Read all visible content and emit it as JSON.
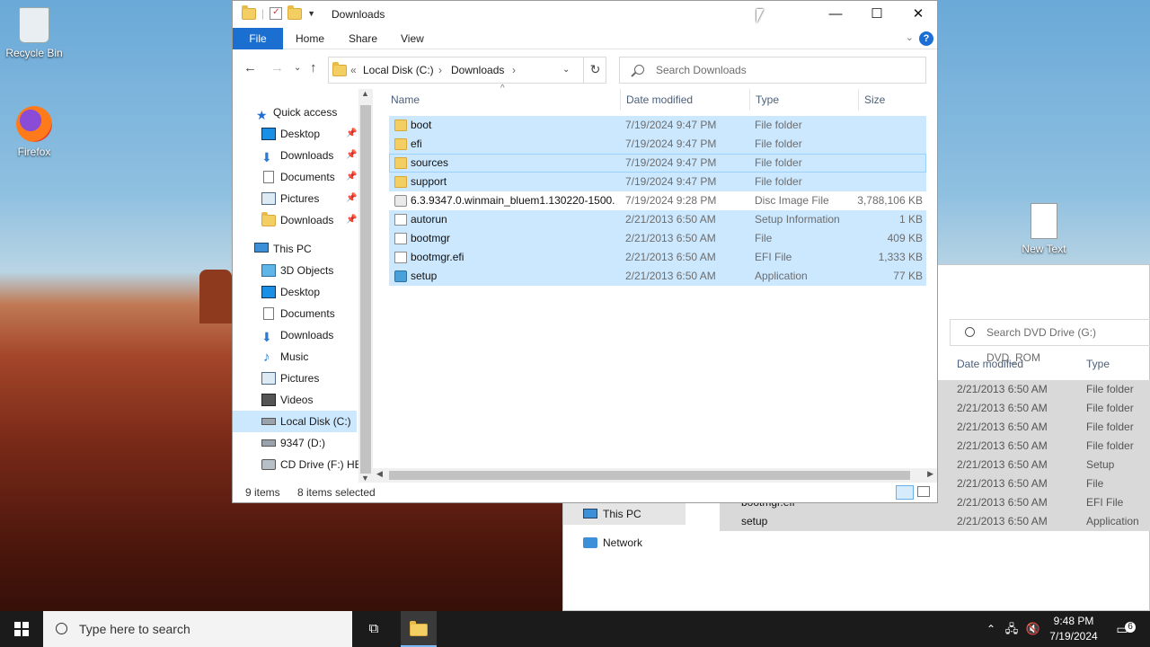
{
  "desktop": {
    "icons": [
      {
        "label": "Recycle Bin",
        "icon": "recycle-bin-icon"
      },
      {
        "label": "Firefox",
        "icon": "firefox-icon"
      },
      {
        "label": "New Text Document",
        "icon": "text-document-icon"
      }
    ]
  },
  "background_window": {
    "search_placeholder": "Search DVD Drive (G:) DVD_ROM",
    "col_date": "Date modified",
    "col_type": "Type",
    "nav": [
      {
        "label": "This PC",
        "icon": "computer-icon"
      },
      {
        "label": "Network",
        "icon": "network-icon"
      }
    ],
    "rows": [
      {
        "name": "",
        "date": "2/21/2013 6:50 AM",
        "type": "File folder"
      },
      {
        "name": "",
        "date": "2/21/2013 6:50 AM",
        "type": "File folder"
      },
      {
        "name": "",
        "date": "2/21/2013 6:50 AM",
        "type": "File folder"
      },
      {
        "name": "",
        "date": "2/21/2013 6:50 AM",
        "type": "File folder"
      },
      {
        "name": "",
        "date": "2/21/2013 6:50 AM",
        "type": "Setup Informa"
      },
      {
        "name": "",
        "date": "2/21/2013 6:50 AM",
        "type": "File"
      },
      {
        "name": "bootmgr.efi",
        "date": "2/21/2013 6:50 AM",
        "type": "EFI File"
      },
      {
        "name": "setup",
        "date": "2/21/2013 6:50 AM",
        "type": "Application"
      }
    ]
  },
  "window": {
    "title": "Downloads",
    "ribbon_tabs": {
      "file": "File",
      "home": "Home",
      "share": "Share",
      "view": "View"
    },
    "help": "?",
    "address": {
      "prefix": "«",
      "drive": "Local Disk (C:)",
      "sep": "›",
      "folder": "Downloads"
    },
    "search_placeholder": "Search Downloads",
    "columns": {
      "name": "Name",
      "date": "Date modified",
      "type": "Type",
      "size": "Size"
    },
    "nav": [
      {
        "label": "Quick access",
        "icon": "star-icon",
        "pinned": false
      },
      {
        "label": "Desktop",
        "icon": "desktop-icon",
        "pinned": true
      },
      {
        "label": "Downloads",
        "icon": "download-arrow-icon",
        "pinned": true
      },
      {
        "label": "Documents",
        "icon": "document-icon",
        "pinned": true
      },
      {
        "label": "Pictures",
        "icon": "pictures-icon",
        "pinned": true
      },
      {
        "label": "Downloads",
        "icon": "folder-icon",
        "pinned": true
      },
      {
        "label": "This PC",
        "icon": "computer-icon",
        "pinned": false
      },
      {
        "label": "3D Objects",
        "icon": "cube-icon",
        "pinned": false
      },
      {
        "label": "Desktop",
        "icon": "desktop-icon",
        "pinned": false
      },
      {
        "label": "Documents",
        "icon": "document-icon",
        "pinned": false
      },
      {
        "label": "Downloads",
        "icon": "download-arrow-icon",
        "pinned": false
      },
      {
        "label": "Music",
        "icon": "music-note-icon",
        "pinned": false
      },
      {
        "label": "Pictures",
        "icon": "pictures-icon",
        "pinned": false
      },
      {
        "label": "Videos",
        "icon": "film-icon",
        "pinned": false
      },
      {
        "label": "Local Disk (C:)",
        "icon": "drive-icon",
        "pinned": false,
        "selected": true
      },
      {
        "label": "9347 (D:)",
        "icon": "drive-icon",
        "pinned": false
      },
      {
        "label": "CD Drive (F:) HB",
        "icon": "cd-drive-icon",
        "pinned": false
      }
    ],
    "files": [
      {
        "name": "boot",
        "date": "7/19/2024 9:47 PM",
        "type": "File folder",
        "size": "",
        "icon": "folder",
        "selected": true
      },
      {
        "name": "efi",
        "date": "7/19/2024 9:47 PM",
        "type": "File folder",
        "size": "",
        "icon": "folder",
        "selected": true
      },
      {
        "name": "sources",
        "date": "7/19/2024 9:47 PM",
        "type": "File folder",
        "size": "",
        "icon": "folder",
        "selected": true,
        "focused": true
      },
      {
        "name": "support",
        "date": "7/19/2024 9:47 PM",
        "type": "File folder",
        "size": "",
        "icon": "folder",
        "selected": true
      },
      {
        "name": "6.3.9347.0.winmain_bluem1.130220-1500...",
        "date": "7/19/2024 9:28 PM",
        "type": "Disc Image File",
        "size": "3,788,106 KB",
        "icon": "disc",
        "selected": false
      },
      {
        "name": "autorun",
        "date": "2/21/2013 6:50 AM",
        "type": "Setup Information",
        "size": "1 KB",
        "icon": "file",
        "selected": true
      },
      {
        "name": "bootmgr",
        "date": "2/21/2013 6:50 AM",
        "type": "File",
        "size": "409 KB",
        "icon": "file",
        "selected": true
      },
      {
        "name": "bootmgr.efi",
        "date": "2/21/2013 6:50 AM",
        "type": "EFI File",
        "size": "1,333 KB",
        "icon": "file",
        "selected": true
      },
      {
        "name": "setup",
        "date": "2/21/2013 6:50 AM",
        "type": "Application",
        "size": "77 KB",
        "icon": "app",
        "selected": true
      }
    ],
    "status": {
      "items": "9 items",
      "selected": "8 items selected"
    }
  },
  "taskbar": {
    "search_placeholder": "Type here to search",
    "time": "9:48 PM",
    "date": "7/19/2024",
    "notification_count": "6"
  },
  "colors": {
    "accent": "#1a6fd1",
    "selection": "#cce8ff",
    "folder": "#f3cf63"
  }
}
